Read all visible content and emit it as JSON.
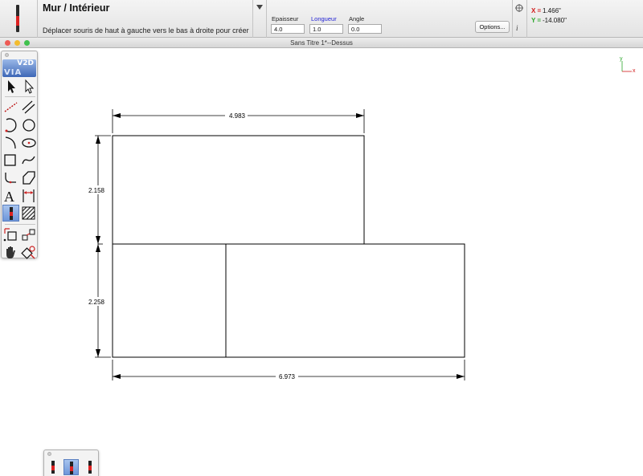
{
  "toolbar": {
    "tool_title": "Mur / Intérieur",
    "tool_hint": "Déplacer souris de haut à gauche vers le bas à droite pour créer",
    "fields": {
      "thickness_label": "Epaisseur",
      "thickness_value": "4.0",
      "length_label": "Longueur",
      "length_value": "1.0",
      "angle_label": "Angle",
      "angle_value": "0.0"
    },
    "options_label": "Options...",
    "info_icon": "i"
  },
  "coordinates": {
    "x_label": "X =",
    "x_value": "1.466\"",
    "y_label": "Y =",
    "y_value": "-14.080\""
  },
  "window": {
    "title": "Sans Titre 1*--Dessus"
  },
  "palette": {
    "logo_top": "V2D",
    "logo_bottom": "VIA"
  },
  "axis": {
    "y_label": "y",
    "x_label": "x"
  },
  "dimensions": {
    "top_width": "4.983",
    "upper_height": "2.158",
    "lower_height": "2.258",
    "bottom_width": "6.973"
  },
  "colors": {
    "accent_blue": "#6c95d9",
    "x_red": "#d21a1a",
    "y_green": "#2aa52a",
    "close": "#ee5b55",
    "minimize": "#f3bc2e",
    "zoom": "#3fc14e"
  },
  "icons": {
    "toolbar": [
      "wall-tool-icon",
      "dropdown-arrow-icon",
      "target-icon",
      "info-icon"
    ],
    "palette": [
      "select-arrow-icon",
      "direct-select-arrow-icon",
      "line-icon",
      "double-line-icon",
      "arc-icon",
      "circle-icon",
      "curve-icon",
      "ellipse-icon",
      "rectangle-icon",
      "spline-icon",
      "fillet-icon",
      "polygon-icon",
      "text-icon",
      "dimension-icon",
      "wall-icon",
      "hatch-icon",
      "scale-icon",
      "transform-icon",
      "hand-pan-icon",
      "symbol-icon"
    ],
    "mini_palette": [
      "wall-left-icon",
      "wall-center-icon",
      "wall-right-icon"
    ]
  }
}
